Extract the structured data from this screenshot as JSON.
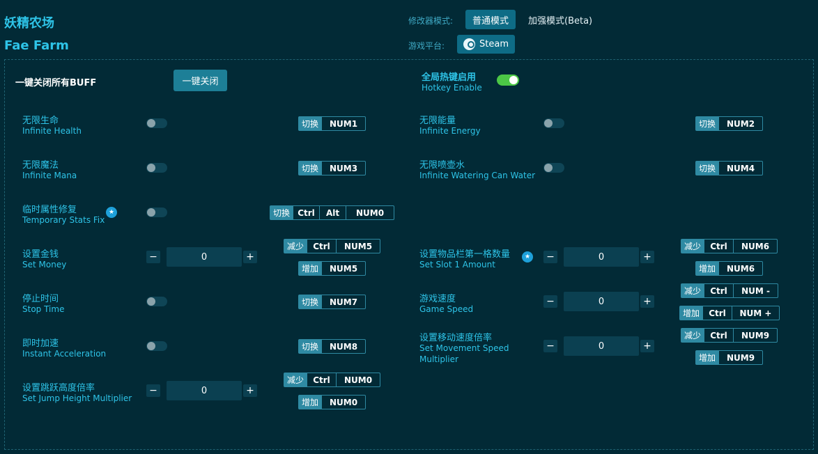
{
  "header": {
    "title_cn": "妖精农场",
    "title_en": "Fae Farm",
    "mode_label": "修改器模式:",
    "mode_normal": "普通模式",
    "mode_enhanced": "加强模式(Beta)",
    "platform_label": "游戏平台:",
    "platform_name": "Steam"
  },
  "global": {
    "all_buff_label": "一键关闭所有BUFF",
    "one_click_close": "一键关闭",
    "hotkey_cn": "全局热键启用",
    "hotkey_en": "Hotkey Enable",
    "hotkey_enabled": true
  },
  "labels": {
    "toggle": "切换",
    "decrease": "减少",
    "increase": "增加"
  },
  "options": {
    "infinite_health": {
      "cn": "无限生命",
      "en": "Infinite Health",
      "keys": [
        "NUM1"
      ]
    },
    "infinite_energy": {
      "cn": "无限能量",
      "en": "Infinite Energy",
      "keys": [
        "NUM2"
      ]
    },
    "infinite_mana": {
      "cn": "无限魔法",
      "en": "Infinite Mana",
      "keys": [
        "NUM3"
      ]
    },
    "infinite_water": {
      "cn": "无限喷壶水",
      "en": "Infinite Watering Can Water",
      "keys": [
        "NUM4"
      ]
    },
    "temp_stats": {
      "cn": "临时属性修复",
      "en": "Temporary Stats Fix",
      "keys": [
        "Ctrl",
        "Alt",
        "NUM0"
      ]
    },
    "set_money": {
      "cn": "设置金钱",
      "en": "Set Money",
      "value": "0",
      "dec_keys": [
        "Ctrl",
        "NUM5"
      ],
      "inc_keys": [
        "NUM5"
      ]
    },
    "slot1": {
      "cn": "设置物品栏第一格数量",
      "en": "Set Slot 1 Amount",
      "value": "0",
      "dec_keys": [
        "Ctrl",
        "NUM6"
      ],
      "inc_keys": [
        "NUM6"
      ]
    },
    "stop_time": {
      "cn": "停止时间",
      "en": "Stop Time",
      "keys": [
        "NUM7"
      ]
    },
    "game_speed": {
      "cn": "游戏速度",
      "en": "Game Speed",
      "value": "0",
      "dec_keys": [
        "Ctrl",
        "NUM -"
      ],
      "inc_keys": [
        "Ctrl",
        "NUM +"
      ]
    },
    "instant_accel": {
      "cn": "即时加速",
      "en": "Instant Acceleration",
      "keys": [
        "NUM8"
      ]
    },
    "move_speed": {
      "cn": "设置移动速度倍率",
      "en": "Set Movement Speed",
      "en2": "Multiplier",
      "value": "0",
      "dec_keys": [
        "Ctrl",
        "NUM9"
      ],
      "inc_keys": [
        "NUM9"
      ]
    },
    "jump_height": {
      "cn": "设置跳跃高度倍率",
      "en": "Set Jump Height Multiplier",
      "value": "0",
      "dec_keys": [
        "Ctrl",
        "NUM0"
      ],
      "inc_keys": [
        "NUM0"
      ]
    }
  },
  "stepper": {
    "minus": "−",
    "plus": "+"
  }
}
